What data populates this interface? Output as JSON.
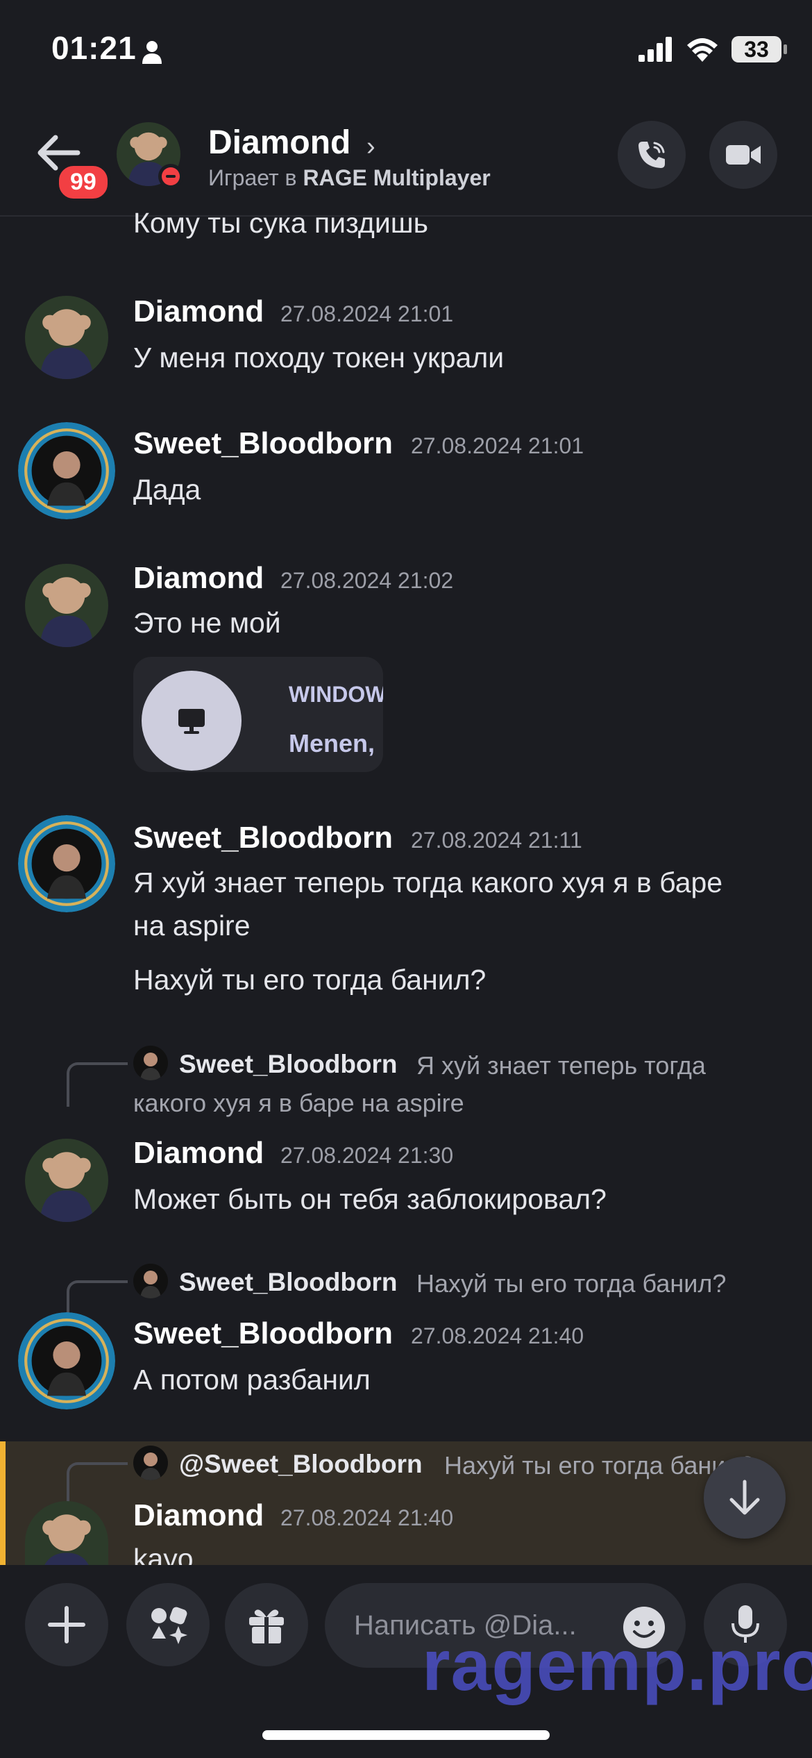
{
  "status": {
    "time": "01:21",
    "battery": "33"
  },
  "header": {
    "badge": "99",
    "title": "Diamond",
    "chevron": "›",
    "subtitle_prefix": "Играет в ",
    "subtitle_game": "RAGE Multiplayer"
  },
  "messages": {
    "partial_top": "Кому ты сука пиздишь",
    "m1": {
      "author": "Diamond",
      "time": "27.08.2024 21:01",
      "text": "У меня походу токен украли"
    },
    "m2": {
      "author": "Sweet_Bloodborn",
      "time": "27.08.2024 21:01",
      "text": "Дада"
    },
    "m3": {
      "author": "Diamond",
      "time": "27.08.2024 21:02",
      "text": "Это не мой",
      "embed": {
        "line1": "WINDOW",
        "line2": "Menen,"
      }
    },
    "m4": {
      "author": "Sweet_Bloodborn",
      "time": "27.08.2024 21:11",
      "line1": "Я хуй знает теперь тогда какого хуя я в баре",
      "line2": "на aspire",
      "line3": "Нахуй ты его тогда банил?"
    },
    "m5": {
      "reply_name": "Sweet_Bloodborn",
      "reply_text1": "Я хуй знает теперь тогда",
      "reply_text2": "какого хуя я в баре на aspire",
      "author": "Diamond",
      "time": "27.08.2024 21:30",
      "text": "Может быть он тебя заблокировал?"
    },
    "m6": {
      "reply_name": "Sweet_Bloodborn",
      "reply_text": "Нахуй ты его тогда банил?",
      "author": "Sweet_Bloodborn",
      "time": "27.08.2024 21:40",
      "text": "А потом разбанил"
    },
    "m7": {
      "reply_name": "@Sweet_Bloodborn",
      "reply_text": "Нахуй ты его тогда банил?",
      "author": "Diamond",
      "time": "27.08.2024 21:40",
      "text": "kayo"
    }
  },
  "composer": {
    "placeholder": "Написать @Dia..."
  },
  "watermark": "ragemp.pro",
  "colors": {
    "background": "#1b1c21",
    "mention_highlight": "#342f27",
    "mention_bar": "#f0b232",
    "dnd_red": "#f23f43"
  }
}
